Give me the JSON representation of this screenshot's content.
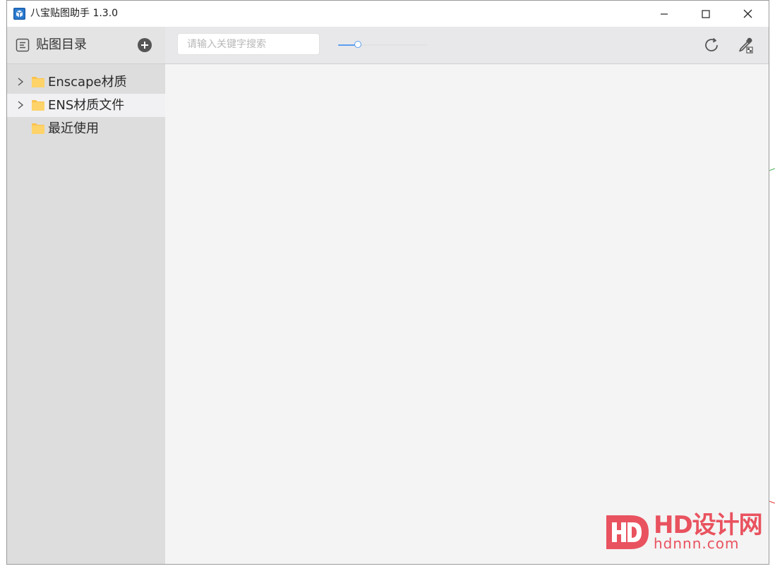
{
  "window": {
    "title": "八宝贴图助手 1.3.0",
    "controls": {
      "minimize": "minimize-icon",
      "maximize": "maximize-icon",
      "close": "close-icon"
    }
  },
  "sidebar": {
    "title": "贴图目录",
    "items": [
      {
        "label": "Enscape材质",
        "expandable": true,
        "selected": false
      },
      {
        "label": "ENS材质文件",
        "expandable": true,
        "selected": true
      },
      {
        "label": "最近使用",
        "expandable": false,
        "selected": false
      }
    ]
  },
  "toolbar": {
    "search_placeholder": "请输入关键字搜索",
    "search_value": "",
    "zoom_slider_level": 0.22
  },
  "watermark": {
    "logo": "HD设计网",
    "domain": "hdnnn.com"
  },
  "colors": {
    "accent": "#5b9ff0",
    "folder": "#fcc24e",
    "watermark": "#e9525f",
    "sidebar_bg": "#dddddd",
    "content_bg": "#f4f4f4"
  }
}
